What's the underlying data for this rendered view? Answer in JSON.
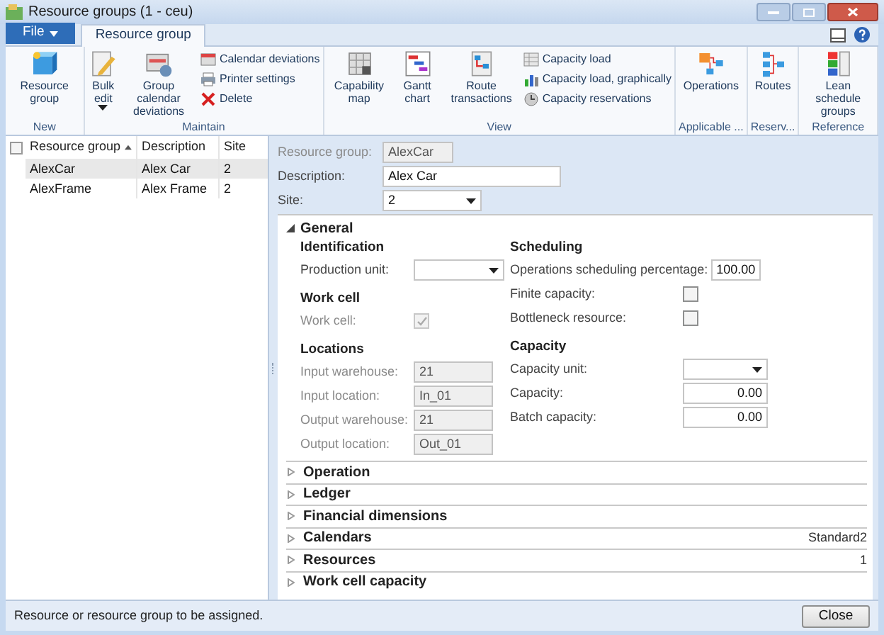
{
  "window": {
    "title": "Resource groups (1 - ceu)"
  },
  "file_menu": {
    "label": "File"
  },
  "tabs": [
    {
      "label": "Resource group",
      "selected": true
    }
  ],
  "ribbon": {
    "groups": [
      {
        "label": "New",
        "items": [
          {
            "kind": "large",
            "label": "Resource group"
          }
        ]
      },
      {
        "label": "Maintain",
        "items": [
          {
            "kind": "large",
            "label": "Bulk edit",
            "dropdown": true
          },
          {
            "kind": "large",
            "label": "Group calendar deviations"
          },
          {
            "kind": "small",
            "label": "Calendar deviations"
          },
          {
            "kind": "small",
            "label": "Printer settings"
          },
          {
            "kind": "small",
            "label": "Delete"
          }
        ]
      },
      {
        "label": "View",
        "items": [
          {
            "kind": "large",
            "label": "Capability map"
          },
          {
            "kind": "large",
            "label": "Gantt chart"
          },
          {
            "kind": "large",
            "label": "Route transactions"
          },
          {
            "kind": "small",
            "label": "Capacity load"
          },
          {
            "kind": "small",
            "label": "Capacity load, graphically"
          },
          {
            "kind": "small",
            "label": "Capacity reservations"
          }
        ]
      },
      {
        "label": "Applicable ...",
        "items": [
          {
            "kind": "large",
            "label": "Operations"
          }
        ]
      },
      {
        "label": "Reserv...",
        "items": [
          {
            "kind": "large",
            "label": "Routes"
          }
        ]
      },
      {
        "label": "Reference",
        "items": [
          {
            "kind": "large",
            "label": "Lean schedule groups"
          }
        ]
      }
    ]
  },
  "list": {
    "select_all": {
      "checked": false
    },
    "columns": [
      {
        "label": "Resource group",
        "sorted": true
      },
      {
        "label": "Description",
        "sorted": false
      },
      {
        "label": "Site",
        "sorted": false
      }
    ],
    "rows": [
      {
        "cells": [
          "AlexCar",
          "Alex Car",
          "2"
        ],
        "selected": true
      },
      {
        "cells": [
          "AlexFrame",
          "Alex Frame",
          "2"
        ],
        "selected": false
      }
    ]
  },
  "header_fields": [
    {
      "kind": "text",
      "label": "Resource group:",
      "value": "AlexCar",
      "disabled": true
    },
    {
      "kind": "text",
      "label": "Description:",
      "value": "Alex Car",
      "disabled": false
    },
    {
      "kind": "dropdown",
      "label": "Site:",
      "value": "2",
      "disabled": false
    }
  ],
  "general": {
    "title": "General",
    "expanded": true,
    "columns": [
      [
        {
          "title": "Identification",
          "fields": [
            {
              "kind": "dropdown",
              "label": "Production unit:",
              "disabled": false
            }
          ]
        },
        {
          "title": "Work cell",
          "fields": [
            {
              "kind": "checkbox",
              "label": "Work cell:",
              "checked": true,
              "disabled": true
            }
          ]
        },
        {
          "title": "Locations",
          "fields": [
            {
              "kind": "text",
              "label": "Input warehouse:",
              "value": "21",
              "disabled": true
            },
            {
              "kind": "text",
              "label": "Input location:",
              "value": "In_01",
              "disabled": true
            },
            {
              "kind": "text",
              "label": "Output warehouse:",
              "value": "21",
              "disabled": true
            },
            {
              "kind": "text",
              "label": "Output location:",
              "value": "Out_01",
              "disabled": true
            }
          ]
        }
      ],
      [
        {
          "title": "Scheduling",
          "fields": [
            {
              "kind": "number",
              "label": "Operations scheduling percentage:",
              "value": "100.00",
              "disabled": false
            },
            {
              "kind": "checkbox",
              "label": "Finite capacity:",
              "checked": false,
              "disabled": false
            },
            {
              "kind": "checkbox",
              "label": "Bottleneck resource:",
              "checked": false,
              "disabled": false
            }
          ]
        },
        {
          "title": "Capacity",
          "fields": [
            {
              "kind": "dropdown",
              "label": "Capacity unit:",
              "disabled": false
            },
            {
              "kind": "number",
              "label": "Capacity:",
              "value": "0.00",
              "disabled": false
            },
            {
              "kind": "number",
              "label": "Batch capacity:",
              "value": "0.00",
              "disabled": false
            }
          ]
        }
      ]
    ]
  },
  "sections": [
    {
      "title": "Operation",
      "expanded": false
    },
    {
      "title": "Ledger",
      "expanded": false
    },
    {
      "title": "Financial dimensions",
      "expanded": false
    },
    {
      "title": "Calendars",
      "expanded": false,
      "summary": "Standard2"
    },
    {
      "title": "Resources",
      "expanded": false,
      "summary": "1"
    },
    {
      "title": "Work cell capacity",
      "expanded": false
    }
  ],
  "status_bar": {
    "text": "Resource or resource group to be assigned.",
    "button": "Close"
  }
}
